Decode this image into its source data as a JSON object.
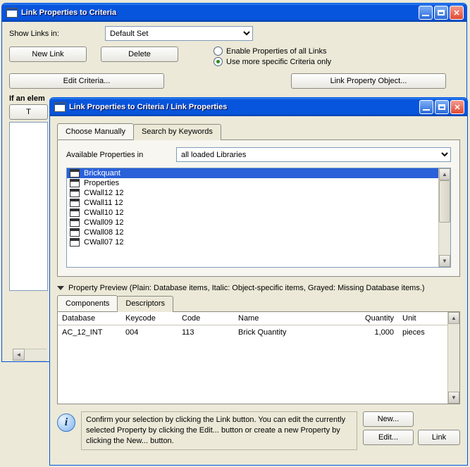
{
  "bgWindow": {
    "title": "Link Properties to Criteria",
    "showLinksLabel": "Show Links in:",
    "showLinksValue": "Default Set",
    "newLink": "New Link",
    "delete": "Delete",
    "editCriteria": "Edit Criteria...",
    "linkPropertyObject": "Link Property Object...",
    "radio1": "Enable Properties of all Links",
    "radio2": "Use more specific Criteria only",
    "ifElem": "If an elem",
    "truncBtn": "T"
  },
  "fgWindow": {
    "title": "Link Properties to Criteria / Link Properties",
    "tabs": {
      "manual": "Choose Manually",
      "search": "Search by Keywords"
    },
    "availLabel": "Available Properties in",
    "availValue": "all loaded Libraries",
    "listItems": [
      "Brickquant",
      "Properties",
      "CWall12 12",
      "CWall11 12",
      "CWall10 12",
      "CWall09 12",
      "CWall08 12",
      "CWall07 12"
    ],
    "previewLabel": "Property Preview (Plain: Database items, Italic: Object-specific items, Grayed: Missing Database items.)",
    "tabs2": {
      "components": "Components",
      "descriptors": "Descriptors"
    },
    "columns": {
      "database": "Database",
      "keycode": "Keycode",
      "code": "Code",
      "name": "Name",
      "quantity": "Quantity",
      "unit": "Unit"
    },
    "row1": {
      "database": "AC_12_INT",
      "keycode": "004",
      "code": "113",
      "name": "Brick Quantity",
      "quantity": "1,000",
      "unit": "pieces"
    },
    "helpText": "Confirm your selection by clicking the Link button. You can edit the currently selected Property by clicking the Edit... button or create a new Property by clicking the New... button.",
    "newBtn": "New...",
    "editBtn": "Edit...",
    "linkBtn": "Link"
  }
}
